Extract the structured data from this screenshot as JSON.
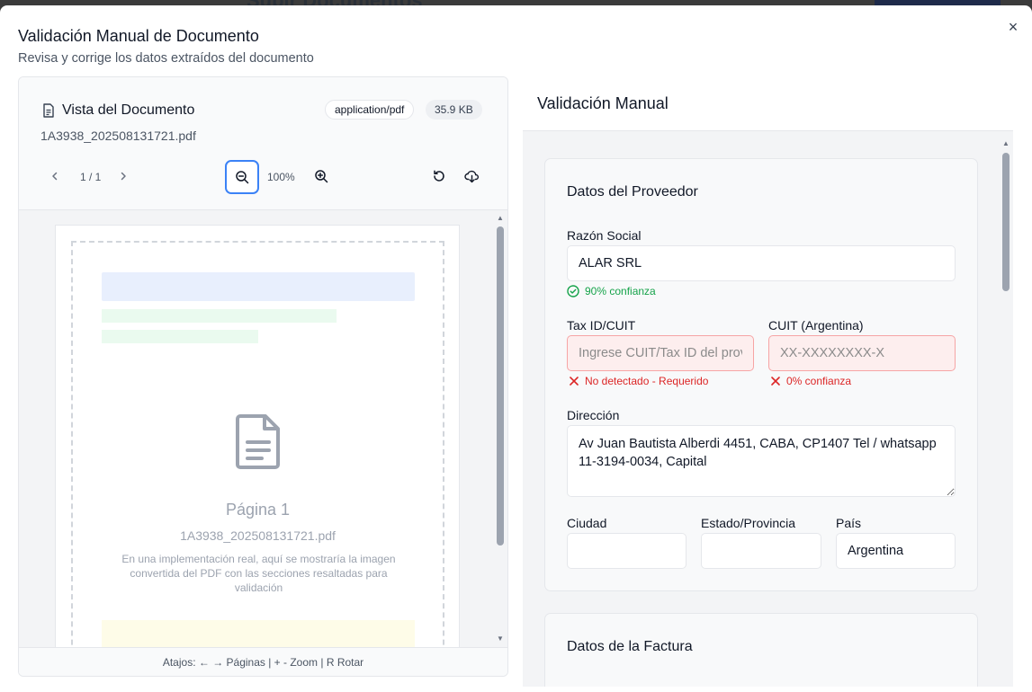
{
  "background": {
    "title": "Subir Documentos"
  },
  "modal": {
    "title": "Validación Manual de Documento",
    "subtitle": "Revisa y corrige los datos extraídos del documento",
    "close_glyph": "×"
  },
  "viewer": {
    "title": "Vista del Documento",
    "mime_badge": "application/pdf",
    "size_badge": "35.9 KB",
    "filename": "1A3938_202508131721.pdf",
    "page_indicator": "1 / 1",
    "zoom_level": "100%",
    "page": {
      "label": "Página 1",
      "filename": "1A3938_202508131721.pdf",
      "description": "En una implementación real, aquí se mostraría la imagen convertida del PDF con las secciones resaltadas para validación"
    },
    "shortcuts": "Atajos: ← → Páginas | + - Zoom | R Rotar",
    "icons": [
      "document-icon",
      "chevron-left-icon",
      "chevron-right-icon",
      "zoom-out-icon",
      "zoom-in-icon",
      "rotate-icon",
      "download-icon"
    ]
  },
  "validation": {
    "title": "Validación Manual",
    "provider_section": {
      "title": "Datos del Proveedor",
      "razon_social": {
        "label": "Razón Social",
        "value": "ALAR SRL",
        "hint": "90% confianza"
      },
      "tax_id": {
        "label": "Tax ID/CUIT",
        "placeholder": "Ingrese CUIT/Tax ID del proveedor",
        "hint": "No detectado - Requerido"
      },
      "cuit_ar": {
        "label": "CUIT (Argentina)",
        "placeholder": "XX-XXXXXXXX-X",
        "hint": "0% confianza"
      },
      "direccion": {
        "label": "Dirección",
        "value": "Av Juan Bautista Alberdi 4451, CABA, CP1407 Tel / whatsapp 11-3194-0034, Capital"
      },
      "ciudad": {
        "label": "Ciudad",
        "value": ""
      },
      "estado": {
        "label": "Estado/Provincia",
        "value": ""
      },
      "pais": {
        "label": "País",
        "value": "Argentina"
      }
    },
    "invoice_section": {
      "title": "Datos de la Factura"
    }
  },
  "colors": {
    "accent": "#3b82f6",
    "success": "#16a34a",
    "error": "#dc2626"
  }
}
